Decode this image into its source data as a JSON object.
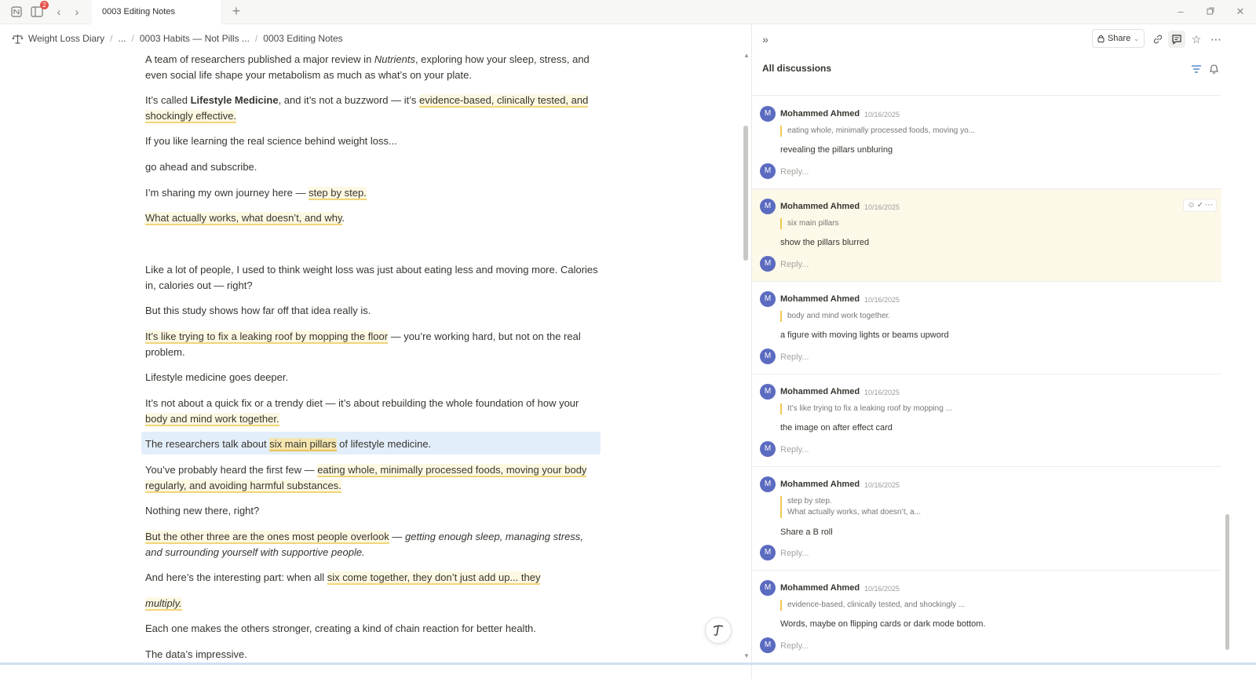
{
  "titlebar": {
    "tab_title": "0003 Editing Notes",
    "notification_count": "2"
  },
  "breadcrumb": {
    "items": [
      "Weight Loss Diary",
      "...",
      "0003 Habits — Not Pills ...",
      "0003 Editing Notes"
    ]
  },
  "document": {
    "p1a": "A team of researchers published a major review in ",
    "p1b": "Nutrients",
    "p1c": ", exploring how your sleep, stress, and even social life shape your metabolism as much as what’s on your plate.",
    "p2a": "It’s called ",
    "p2b": "Lifestyle Medicine",
    "p2c": ", and it’s not a buzzword — it’s ",
    "p2d": "evidence-based, clinically tested, and shockingly effective.",
    "p3": "If you like learning the real science behind weight loss...",
    "p4": "go ahead and subscribe.",
    "p5a": "I’m sharing my own journey here — ",
    "p5b": "step by step.",
    "p6a": "What actually works, what doesn’t, and why",
    "p6b": ".",
    "p7": "Like a lot of people, I used to think weight loss was just about eating less and moving more. Calories in, calories out — right?",
    "p8": "But this study shows how far off that idea really is.",
    "p9a": "It’s like trying to fix a leaking roof by mopping the floor",
    "p9b": " — you’re working hard, but not on the real problem.",
    "p10": "Lifestyle medicine goes deeper.",
    "p11a": "It’s not about a quick fix or a trendy diet — it’s about rebuilding the whole foundation of how your ",
    "p11b": "body and mind work together.",
    "p12a": "The researchers talk about ",
    "p12b": "six main pillars",
    "p12c": " of lifestyle medicine.",
    "p13a": "You’ve probably heard the first few — ",
    "p13b": "eating whole, minimally processed foods, moving your body regularly, and avoiding harmful substances.",
    "p14": "Nothing new there, right?",
    "p15a": "But the other three are the ones most people overlook",
    "p15b": " — ",
    "p15c": "getting enough sleep, managing stress, and surrounding yourself with supportive people.",
    "p16a": "And here’s the interesting part: when all ",
    "p16b": "six come together, they don’t just add up... they",
    "p17": "multiply.",
    "p18": "Each one makes the others stronger, creating a kind of chain reaction for better health.",
    "p19": "The data’s impressive."
  },
  "panel": {
    "share_label": "Share",
    "title": "All discussions",
    "reply_placeholder": "Reply...",
    "avatar_letter": "M",
    "threads": [
      {
        "author": "Mohammed Ahmed",
        "date": "10/16/2025",
        "quote": "eating whole, minimally processed foods, moving yo...",
        "comment": "revealing the pillars unbluring"
      },
      {
        "author": "Mohammed Ahmed",
        "date": "10/16/2025",
        "quote": "six main pillars",
        "comment": "show the pillars blurred"
      },
      {
        "author": "Mohammed Ahmed",
        "date": "10/16/2025",
        "quote": "body and mind work together.",
        "comment": "a figure with moving lights or beams upword"
      },
      {
        "author": "Mohammed Ahmed",
        "date": "10/16/2025",
        "quote": "It’s like trying to fix a leaking roof by mopping ...",
        "comment": "the image on after effect card"
      },
      {
        "author": "Mohammed Ahmed",
        "date": "10/16/2025",
        "quote": "step by step.",
        "quote2": "What actually works, what doesn’t, a...",
        "comment": "Share a B roll"
      },
      {
        "author": "Mohammed Ahmed",
        "date": "10/16/2025",
        "quote": "evidence-based, clinically tested, and shockingly ...",
        "comment": "Words, maybe on flipping cards or dark mode bottom."
      }
    ]
  },
  "colors": {
    "highlight": "#f1d57a",
    "selection": "#e3eefb",
    "avatar": "#5b6bc0",
    "active_thread": "#fdf9e9"
  }
}
